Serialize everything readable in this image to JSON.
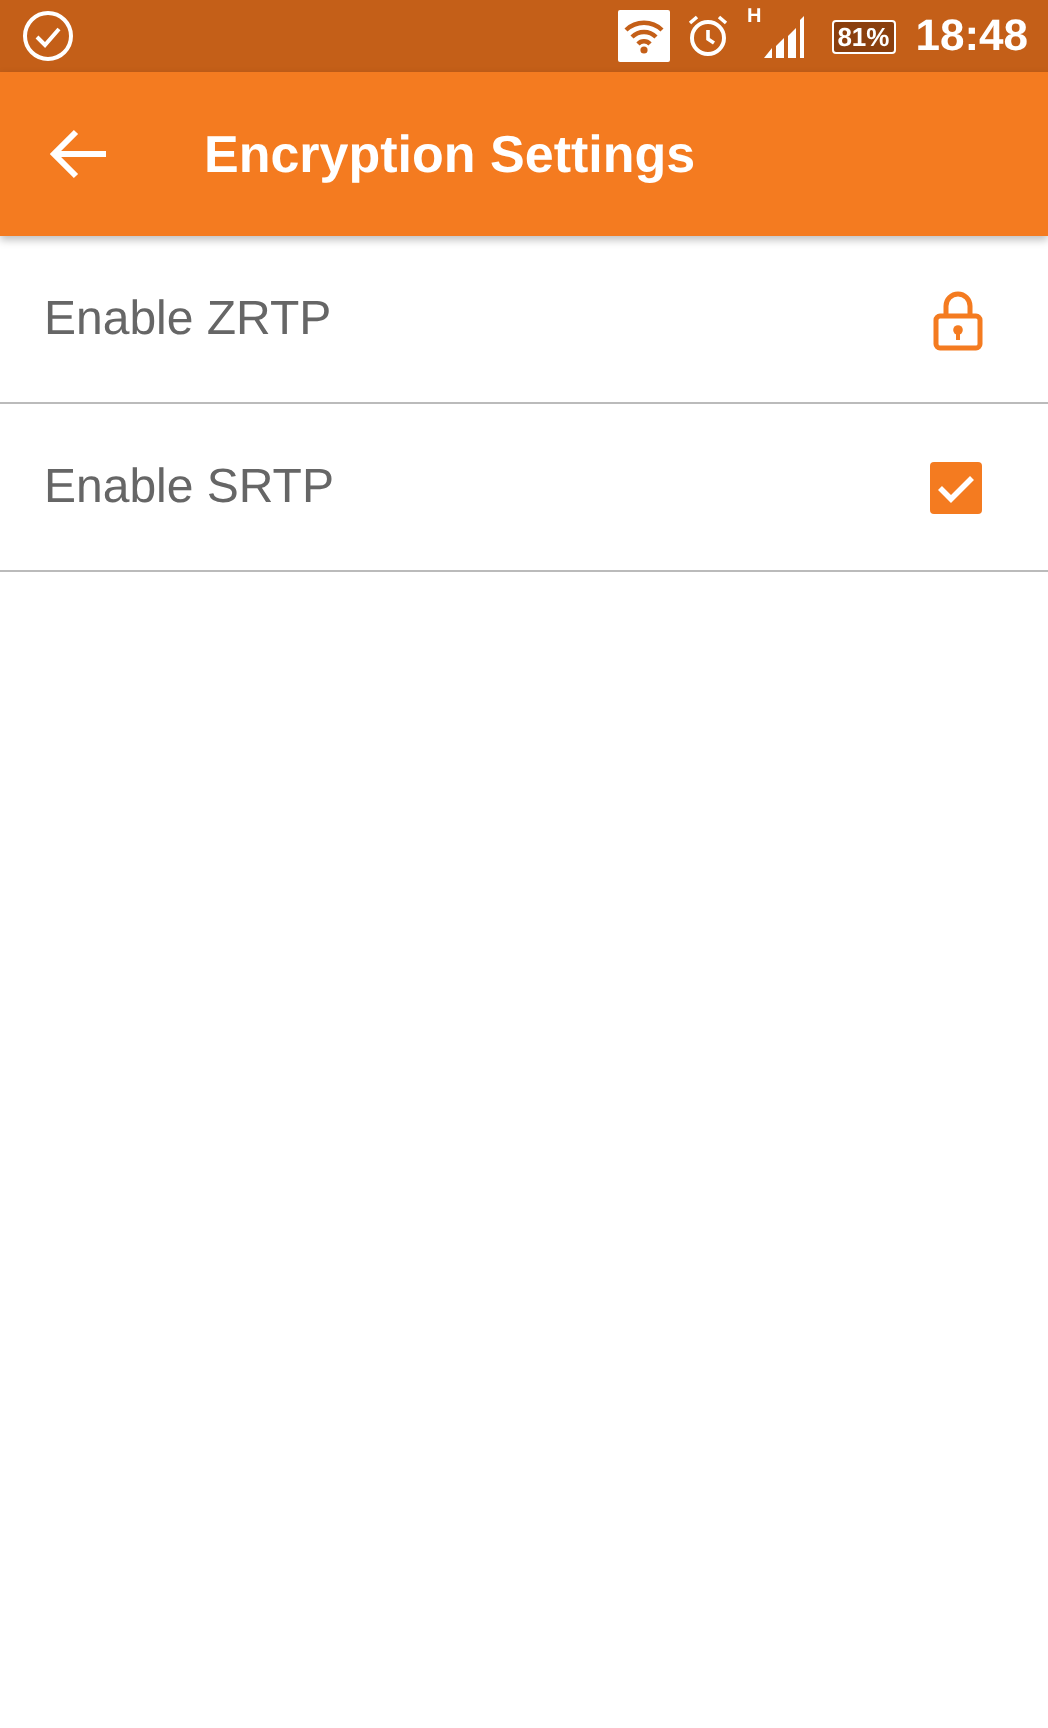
{
  "status_bar": {
    "network_type": "H",
    "battery": "81%",
    "time": "18:48"
  },
  "app_bar": {
    "title": "Encryption Settings"
  },
  "settings": [
    {
      "kind": "lock",
      "label": "Enable ZRTP"
    },
    {
      "kind": "checkbox",
      "label": "Enable SRTP",
      "checked": true
    }
  ]
}
